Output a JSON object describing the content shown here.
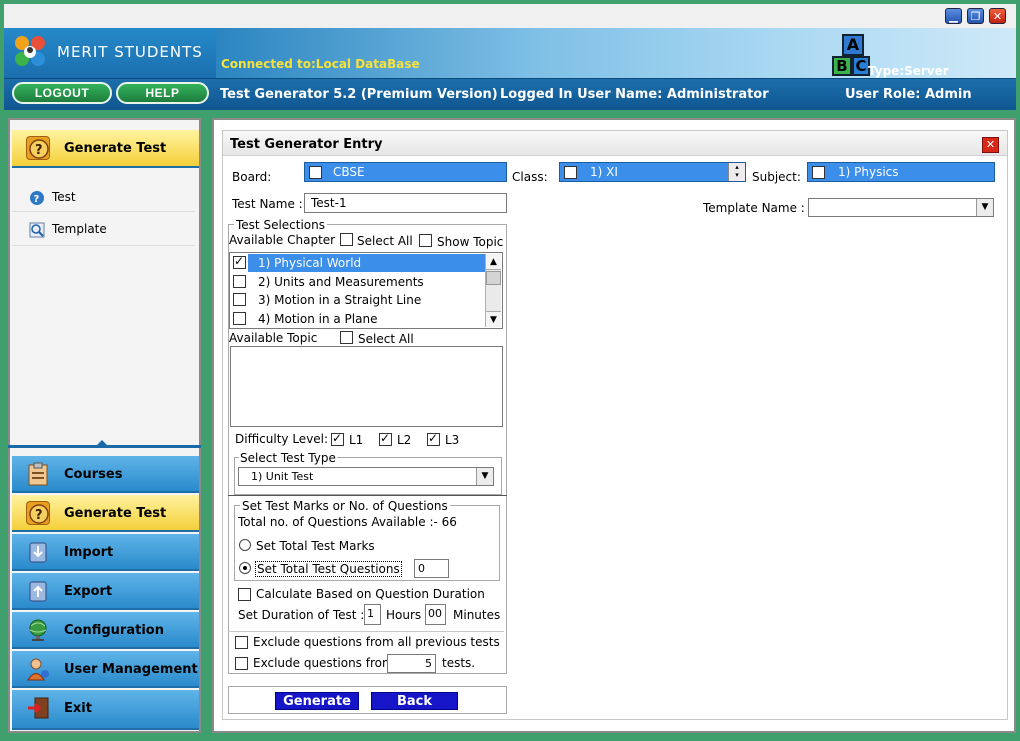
{
  "window": {
    "minimize_icon": "minimize-icon",
    "restore_icon": "restore-icon",
    "close_icon": "close-icon"
  },
  "brand": {
    "name": "MERIT STUDENTS",
    "connection": "Connected to:Local DataBase",
    "type": "Type:Server",
    "abc": [
      "A",
      "B",
      "C"
    ]
  },
  "nav": {
    "logout": "LOGOUT",
    "help": "HELP",
    "app_title": "Test Generator 5.2 (Premium Version)",
    "logged_in": "Logged In User Name:  Administrator",
    "role": "User Role: Admin"
  },
  "sidebar": {
    "header": "Generate Test",
    "items": [
      {
        "label": "Test",
        "icon": "help-icon"
      },
      {
        "label": "Template",
        "icon": "magnifier-icon"
      }
    ],
    "menu": [
      {
        "label": "Courses",
        "icon": "clipboard-icon"
      },
      {
        "label": "Generate Test",
        "icon": "question-icon"
      },
      {
        "label": "Import",
        "icon": "import-icon"
      },
      {
        "label": "Export",
        "icon": "export-icon"
      },
      {
        "label": "Configuration",
        "icon": "globe-icon"
      },
      {
        "label": "User Management",
        "icon": "user-icon"
      },
      {
        "label": "Exit",
        "icon": "exit-icon"
      }
    ]
  },
  "panel": {
    "title": "Test Generator Entry",
    "board_label": "Board:",
    "board_value": "CBSE",
    "class_label": "Class:",
    "class_value": "1) XI",
    "subject_label": "Subject:",
    "subject_value": "1) Physics",
    "test_name_label": "Test Name :",
    "test_name_value": "Test-1",
    "template_label": "Template Name :",
    "template_value": "",
    "test_selections": "Test Selections",
    "available_chapter": "Available Chapter",
    "select_all": "Select All",
    "show_topic": "Show Topic",
    "chapters": [
      {
        "label": "1) Physical World",
        "checked": true,
        "selected": true
      },
      {
        "label": "2) Units and Measurements",
        "checked": false
      },
      {
        "label": "3) Motion in a Straight Line",
        "checked": false
      },
      {
        "label": "4) Motion in a Plane",
        "checked": false
      }
    ],
    "available_topic": "Available Topic",
    "topic_select_all": "Select All",
    "difficulty_label": "Difficulty Level:",
    "levels": [
      "L1",
      "L2",
      "L3"
    ],
    "select_test_type": "Select Test Type",
    "test_type_value": "1) Unit Test",
    "marks_group": "Set Test Marks  or  No. of Questions",
    "total_available": "Total no. of Questions Available :- 66",
    "opt_marks": "Set Total Test Marks",
    "opt_questions": "Set Total Test Questions",
    "questions_value": "0",
    "calc_duration": "Calculate Based on Question Duration",
    "duration_label": "Set Duration of Test :",
    "hours_value": "1",
    "hours": "Hours",
    "minutes_value": "00",
    "minutes": "Minutes",
    "exclude_all": "Exclude questions from all previous tests",
    "exclude_from": "Exclude questions from",
    "exclude_count": "5",
    "tests": "tests.",
    "generate": "Generate",
    "back": "Back"
  }
}
